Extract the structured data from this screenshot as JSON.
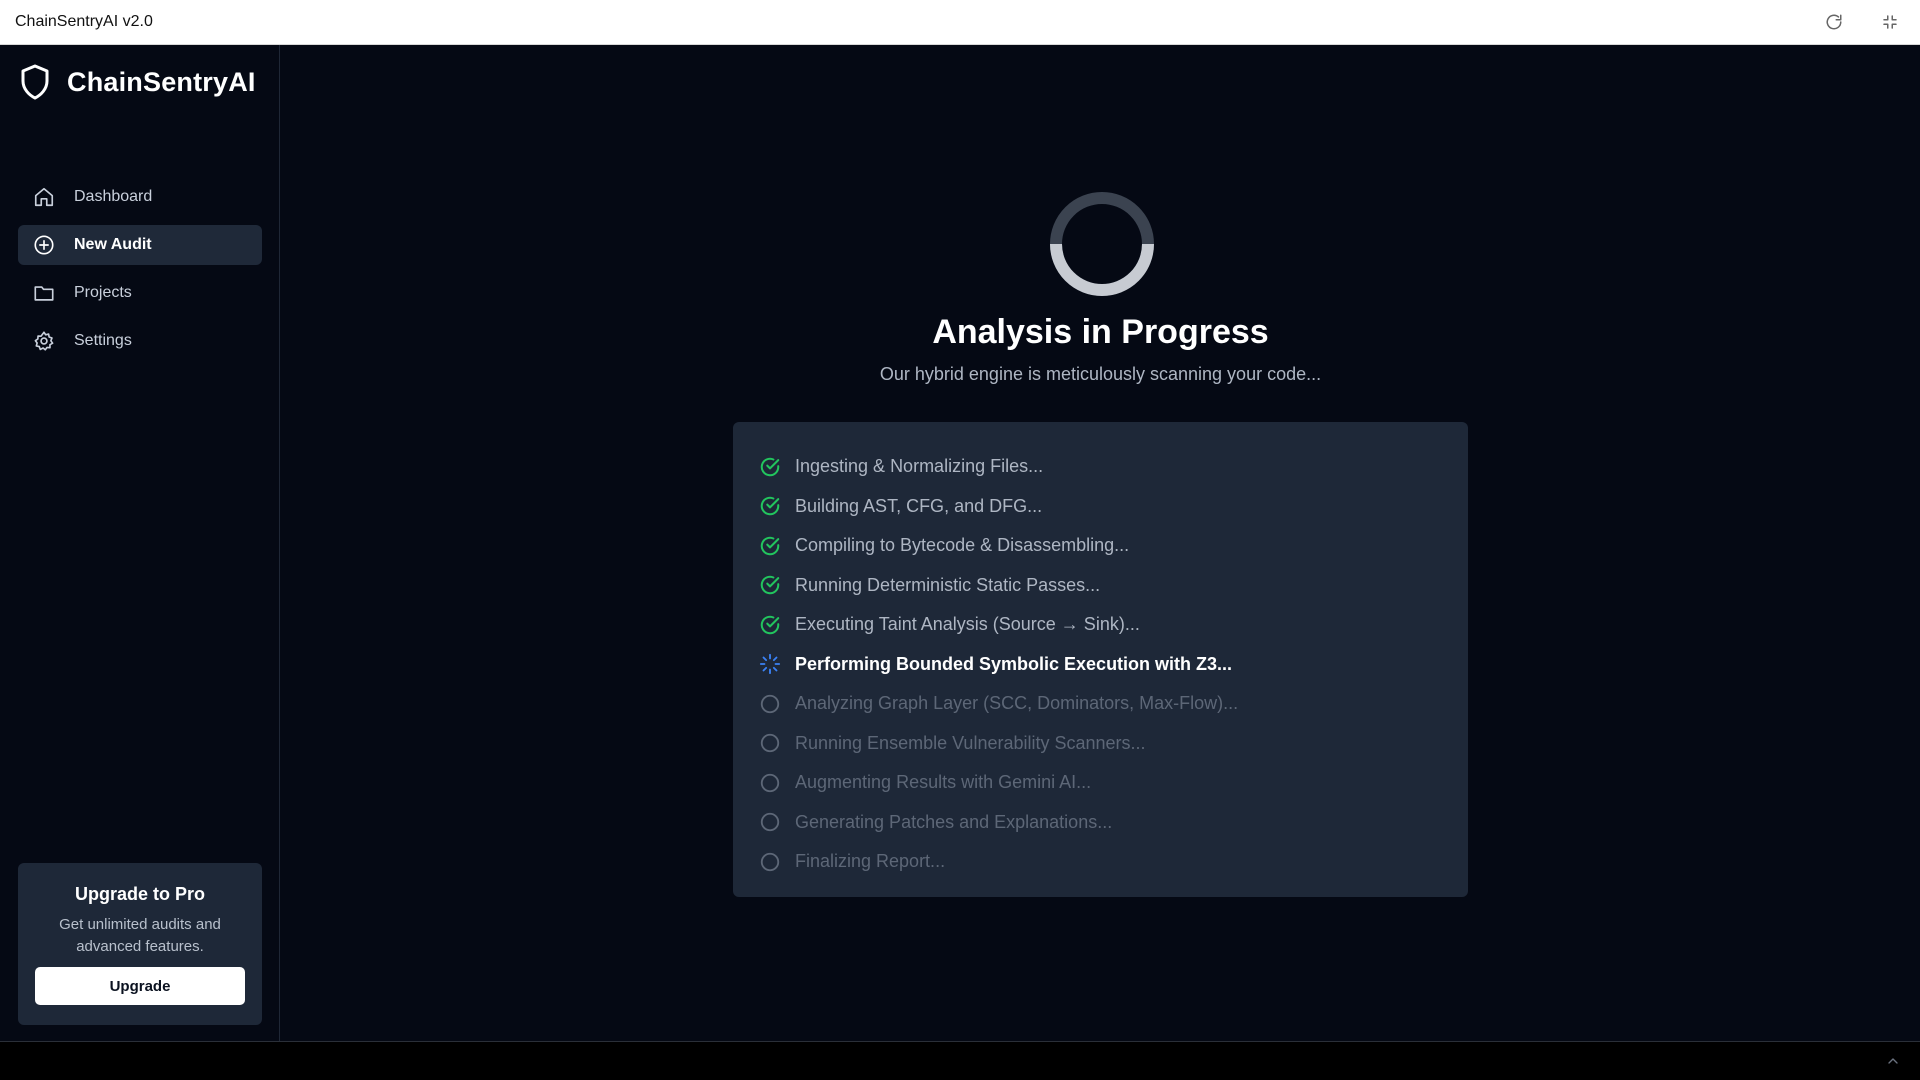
{
  "window": {
    "title": "ChainSentryAI v2.0",
    "refresh_icon": "refresh-icon",
    "fullscreen_icon": "exit-fullscreen-icon"
  },
  "sidebar": {
    "brand": {
      "name": "ChainSentryAI",
      "icon": "shield-icon"
    },
    "items": [
      {
        "label": "Dashboard",
        "icon": "home-icon",
        "active": false
      },
      {
        "label": "New Audit",
        "icon": "plus-circle-icon",
        "active": true
      },
      {
        "label": "Projects",
        "icon": "folder-icon",
        "active": false
      },
      {
        "label": "Settings",
        "icon": "gear-icon",
        "active": false
      }
    ],
    "upgrade": {
      "title": "Upgrade to Pro",
      "description": "Get unlimited audits and advanced features.",
      "button_label": "Upgrade"
    }
  },
  "main": {
    "heading": "Analysis in Progress",
    "subheading": "Our hybrid engine is meticulously scanning your code...",
    "steps": [
      {
        "label": "Ingesting & Normalizing Files...",
        "status": "done"
      },
      {
        "label": "Building AST, CFG, and DFG...",
        "status": "done"
      },
      {
        "label": "Compiling to Bytecode & Disassembling...",
        "status": "done"
      },
      {
        "label": "Running Deterministic Static Passes...",
        "status": "done"
      },
      {
        "label": "Executing Taint Analysis (Source → Sink)...",
        "status": "done"
      },
      {
        "label": "Performing Bounded Symbolic Execution with Z3...",
        "status": "in-progress"
      },
      {
        "label": "Analyzing Graph Layer (SCC, Dominators, Max-Flow)...",
        "status": "pending"
      },
      {
        "label": "Running Ensemble Vulnerability Scanners...",
        "status": "pending"
      },
      {
        "label": "Augmenting Results with Gemini AI...",
        "status": "pending"
      },
      {
        "label": "Generating Patches and Explanations...",
        "status": "pending"
      },
      {
        "label": "Finalizing Report...",
        "status": "pending"
      }
    ]
  },
  "colors": {
    "background": "#050914",
    "panel": "#1e2838",
    "active_nav": "#1f2939",
    "done_check": "#22c55e",
    "in_progress": "#3b82f6",
    "pending": "#5d6777"
  }
}
